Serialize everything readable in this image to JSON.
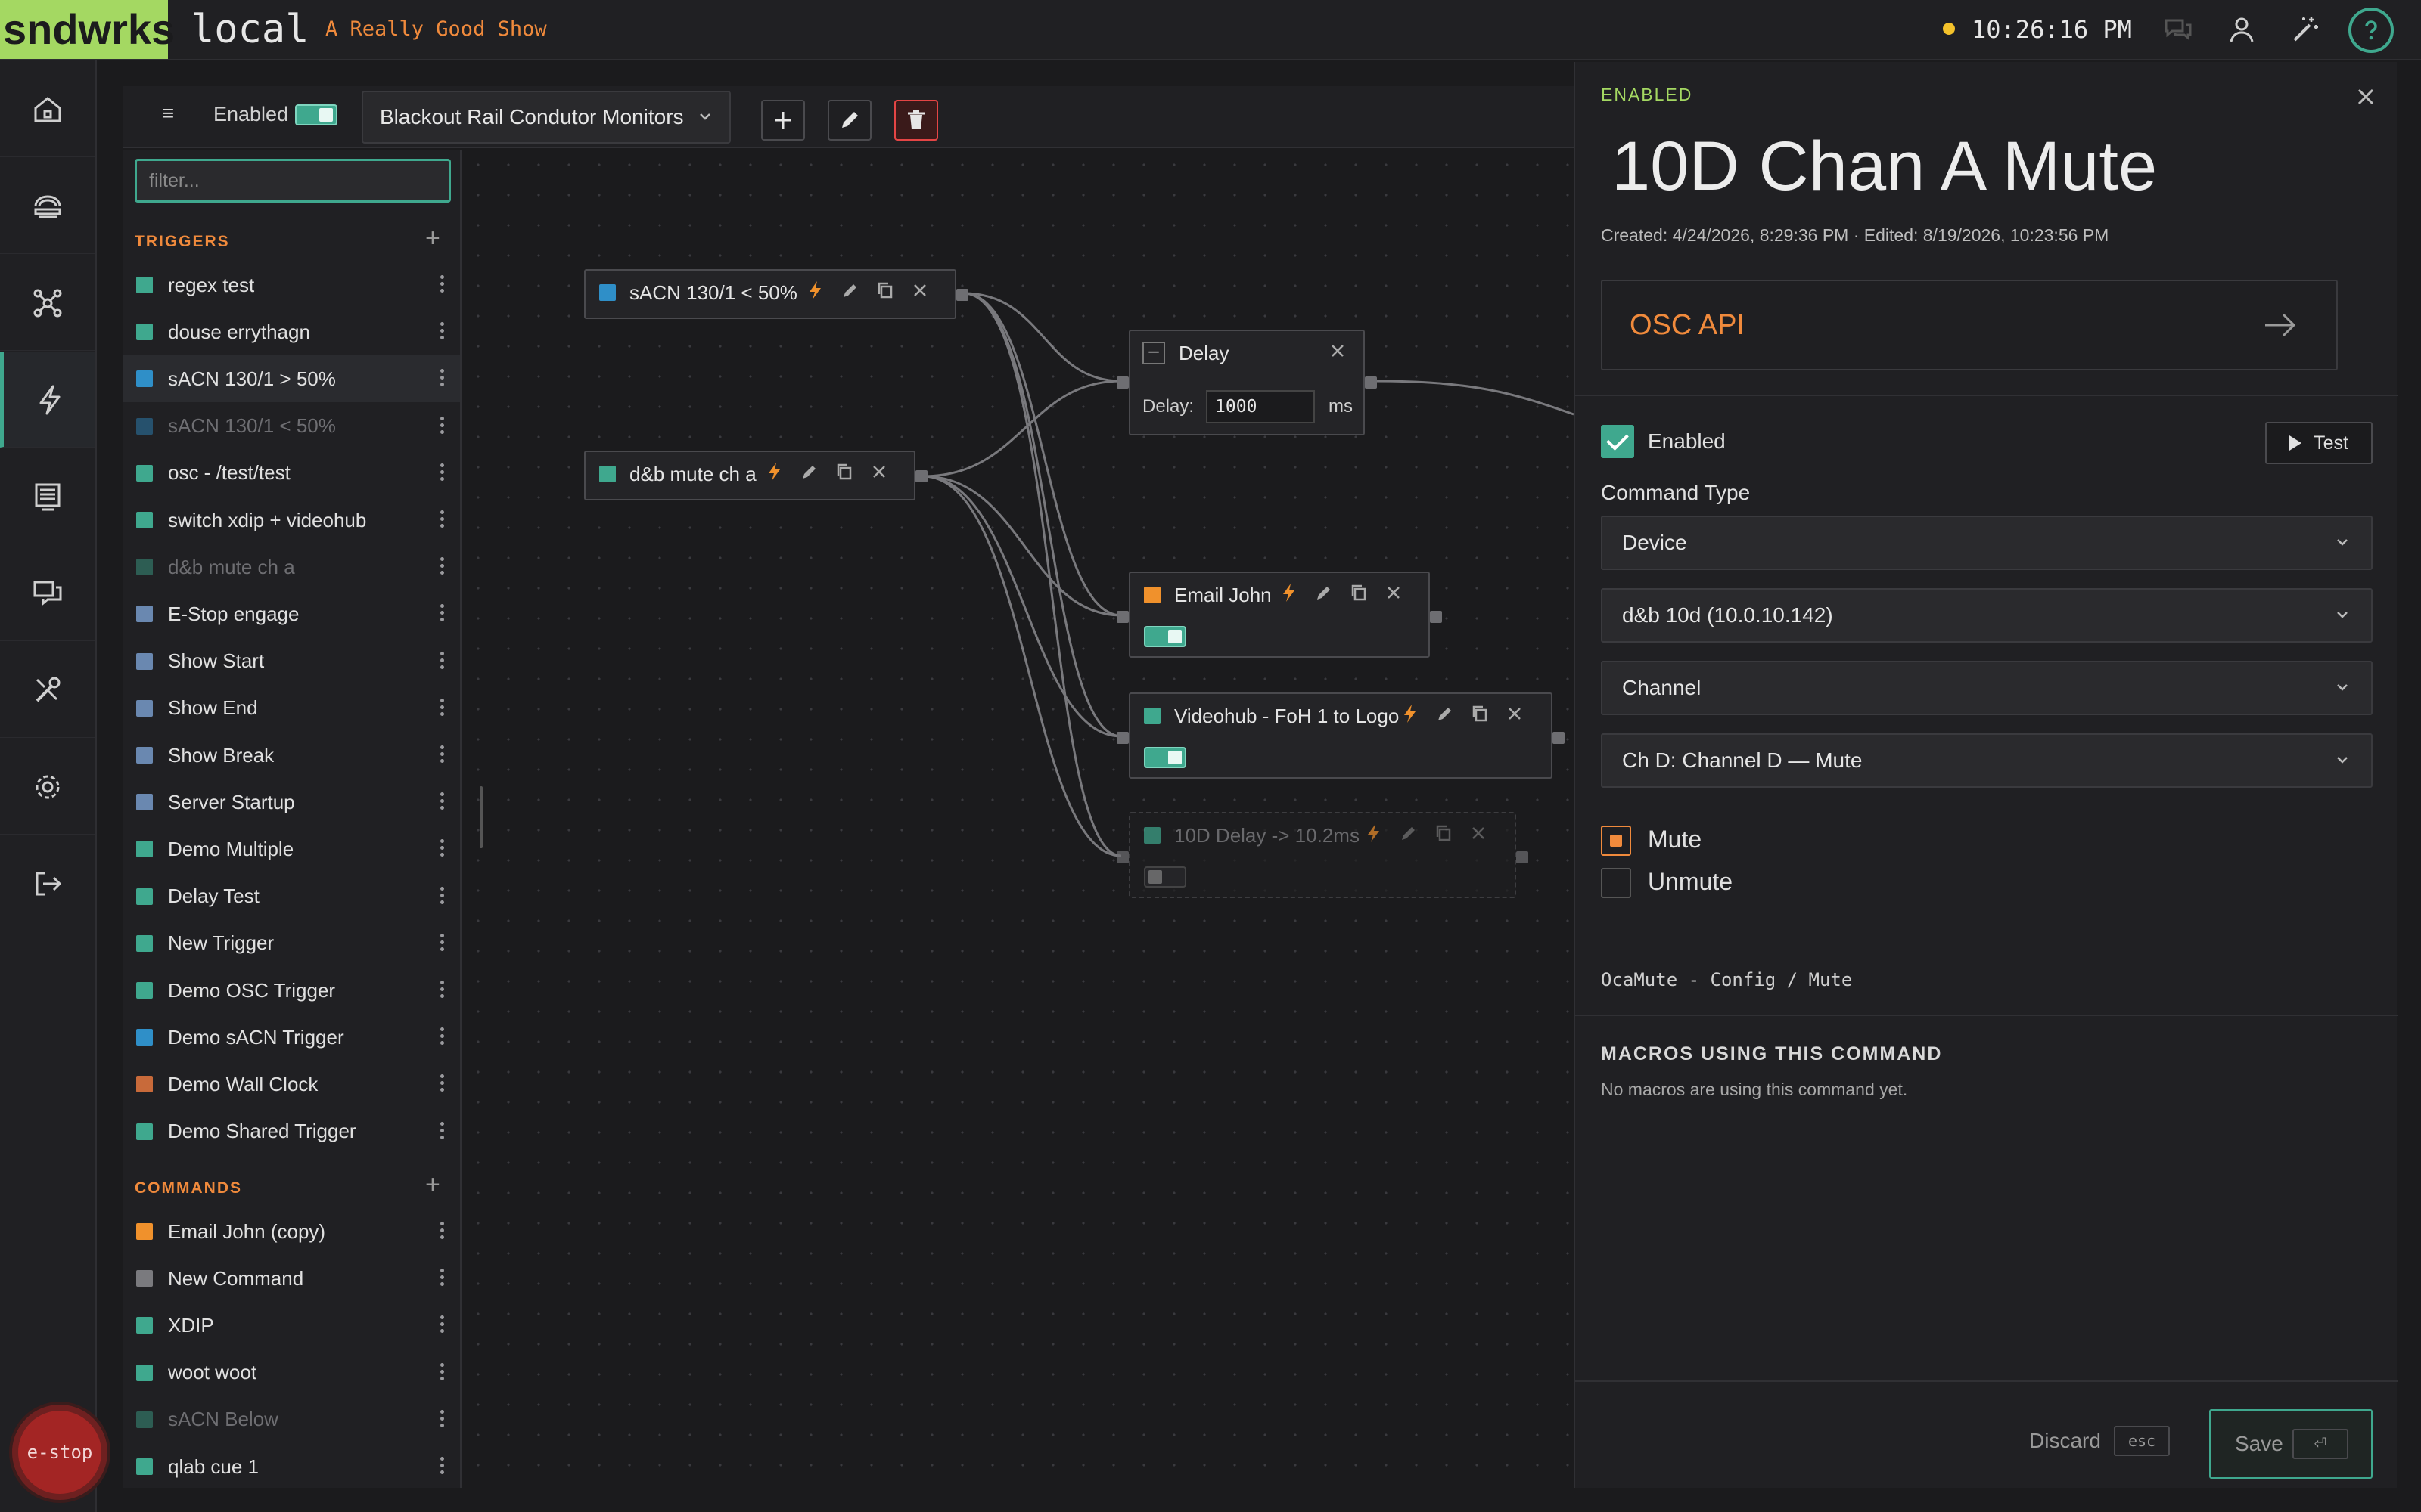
{
  "topbar": {
    "logo": "sndwrks",
    "environment": "local",
    "show_name": "A Really Good Show",
    "clock": "10:26:16 PM",
    "status_color": "#f4c22b",
    "icons": [
      "chat-icon",
      "user-icon",
      "magic-wand-icon",
      "help-icon"
    ]
  },
  "rail": {
    "items": [
      "home-icon",
      "network-icon",
      "nodes-icon",
      "lightning-icon",
      "display-icon",
      "chat-screens-icon",
      "tools-icon",
      "settings-icon",
      "logout-icon"
    ],
    "active": "lightning-icon",
    "estop_label": "e-stop"
  },
  "toolbar": {
    "menu_glyph": "≡",
    "enabled_label": "Enabled",
    "enabled": true,
    "macro_name": "Blackout Rail Condutor Monitors"
  },
  "sidebar": {
    "filter_placeholder": "filter...",
    "triggers_header": "TRIGGERS",
    "commands_header": "COMMANDS",
    "triggers": [
      {
        "label": "regex test",
        "color": "#3fa88e",
        "dim": false
      },
      {
        "label": "douse errythagn",
        "color": "#3fa88e",
        "dim": false
      },
      {
        "label": "sACN 130/1 > 50%",
        "color": "#2f8fc8",
        "dim": false,
        "selected": true
      },
      {
        "label": "sACN 130/1 < 50%",
        "color": "#2f8fc8",
        "dim": true
      },
      {
        "label": "osc - /test/test",
        "color": "#3fa88e",
        "dim": false
      },
      {
        "label": "switch xdip + videohub",
        "color": "#3fa88e",
        "dim": false
      },
      {
        "label": "d&b mute ch a",
        "color": "#3fa88e",
        "dim": true
      },
      {
        "label": "E-Stop engage",
        "color": "#6a88b0",
        "dim": false
      },
      {
        "label": "Show Start",
        "color": "#6a88b0",
        "dim": false
      },
      {
        "label": "Show End",
        "color": "#6a88b0",
        "dim": false
      },
      {
        "label": "Show Break",
        "color": "#6a88b0",
        "dim": false
      },
      {
        "label": "Server Startup",
        "color": "#6a88b0",
        "dim": false
      },
      {
        "label": "Demo Multiple",
        "color": "#3fa88e",
        "dim": false
      },
      {
        "label": "Delay Test",
        "color": "#3fa88e",
        "dim": false
      },
      {
        "label": "New Trigger",
        "color": "#3fa88e",
        "dim": false
      },
      {
        "label": "Demo OSC Trigger",
        "color": "#3fa88e",
        "dim": false
      },
      {
        "label": "Demo sACN Trigger",
        "color": "#2f8fc8",
        "dim": false
      },
      {
        "label": "Demo Wall Clock",
        "color": "#c86a3a",
        "dim": false
      },
      {
        "label": "Demo Shared Trigger",
        "color": "#3fa88e",
        "dim": false
      }
    ],
    "commands": [
      {
        "label": "Email John (copy)",
        "color": "#f0912c",
        "dim": false
      },
      {
        "label": "New Command",
        "color": "#7a7a7e",
        "dim": false
      },
      {
        "label": "XDIP",
        "color": "#3fa88e",
        "dim": false
      },
      {
        "label": "woot woot",
        "color": "#3fa88e",
        "dim": false
      },
      {
        "label": "sACN Below",
        "color": "#3fa88e",
        "dim": true
      },
      {
        "label": "qlab cue 1",
        "color": "#3fa88e",
        "dim": false
      }
    ]
  },
  "graph": {
    "trigger1": {
      "label": "sACN 130/1 < 50%",
      "color": "#2f8fc8"
    },
    "trigger2": {
      "label": "d&b mute ch a",
      "color": "#3fa88e"
    },
    "delay": {
      "label": "Delay",
      "field_label": "Delay:",
      "value": "1000",
      "unit": "ms"
    },
    "cmd1": {
      "label": "Email John",
      "color": "#f0912c",
      "enabled": true
    },
    "cmd2": {
      "label": "Videohub - FoH 1 to Logo",
      "color": "#3fa88e",
      "enabled": true
    },
    "cmd3": {
      "label": "10D Delay -> 10.2ms",
      "color": "#3fa88e",
      "enabled": false
    }
  },
  "panel": {
    "state": "ENABLED",
    "title": "10D Chan A Mute",
    "meta": "Created: 4/24/2026, 8:29:36 PM · Edited: 8/19/2026, 10:23:56 PM",
    "api_label": "OSC API",
    "enabled_label": "Enabled",
    "enabled": true,
    "test_label": "Test",
    "command_type_label": "Command Type",
    "command_type": "Device",
    "device": "d&b 10d (10.0.10.142)",
    "category": "Channel",
    "parameter": "Ch D: Channel D — Mute",
    "options": [
      {
        "label": "Mute",
        "selected": true
      },
      {
        "label": "Unmute",
        "selected": false
      }
    ],
    "oca_path": "OcaMute - Config / Mute",
    "macros_header": "MACROS USING THIS COMMAND",
    "macros_empty": "No macros are using this command yet.",
    "discard_label": "Discard",
    "discard_key": "esc",
    "save_label": "Save",
    "save_key": "⏎",
    "accent": "#3fa88e",
    "warn": "#f08a3c"
  }
}
